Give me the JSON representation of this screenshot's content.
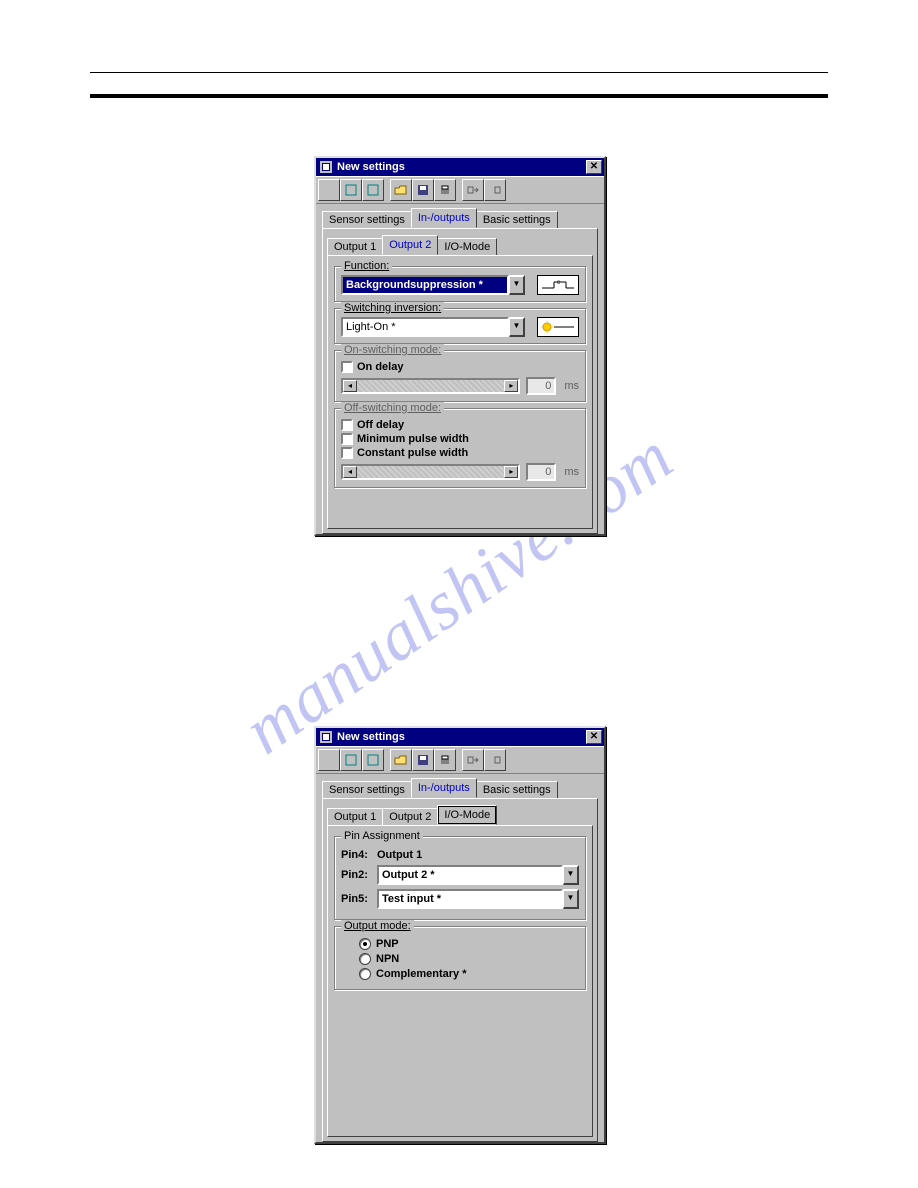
{
  "watermark": "manualshive.com",
  "dialog1": {
    "title": "New settings",
    "tabs_main": {
      "sensor": "Sensor settings",
      "io": "In-/outputs",
      "basic": "Basic settings"
    },
    "tabs_sub": {
      "out1": "Output 1",
      "out2": "Output 2",
      "iomode": "I/O-Mode"
    },
    "function": {
      "legend": "Function:",
      "value": "Backgroundsuppression *"
    },
    "switching_inversion": {
      "legend": "Switching inversion:",
      "value": "Light-On *"
    },
    "on_switching": {
      "legend": "On-switching mode:",
      "on_delay": "On delay",
      "value": "0",
      "unit": "ms"
    },
    "off_switching": {
      "legend": "Off-switching mode:",
      "off_delay": "Off delay",
      "min_pulse": "Minimum pulse width",
      "const_pulse": "Constant pulse width",
      "value": "0",
      "unit": "ms"
    }
  },
  "dialog2": {
    "title": "New settings",
    "tabs_main": {
      "sensor": "Sensor settings",
      "io": "In-/outputs",
      "basic": "Basic settings"
    },
    "tabs_sub": {
      "out1": "Output 1",
      "out2": "Output 2",
      "iomode": "I/O-Mode"
    },
    "pin_assignment": {
      "legend": "Pin Assignment",
      "pin4_label": "Pin4:",
      "pin4_value": "Output 1",
      "pin2_label": "Pin2:",
      "pin2_value": "Output 2 *",
      "pin5_label": "Pin5:",
      "pin5_value": "Test input *"
    },
    "output_mode": {
      "legend": "Output mode:",
      "pnp": "PNP",
      "npn": "NPN",
      "comp": "Complementary *",
      "selected": "pnp"
    }
  }
}
